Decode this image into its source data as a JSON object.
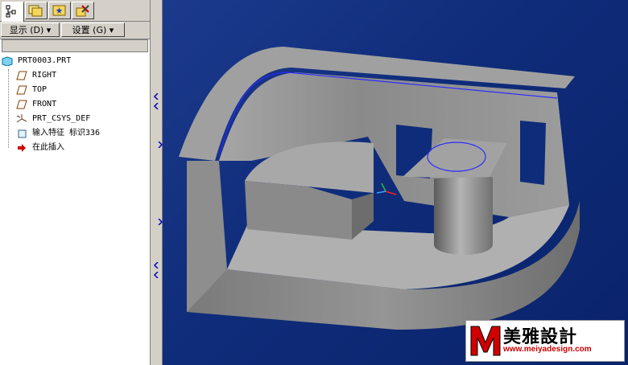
{
  "tabs": [
    {
      "icon": "model-tree-icon"
    },
    {
      "icon": "folder-browser-icon"
    },
    {
      "icon": "favorites-icon"
    },
    {
      "icon": "tools-icon"
    }
  ],
  "menu": {
    "display_label": "显示 (D)",
    "settings_label": "设置 (G)"
  },
  "tree": {
    "root": "PRT0003.PRT",
    "items": [
      {
        "label": "RIGHT",
        "icon": "datum-plane-icon"
      },
      {
        "label": "TOP",
        "icon": "datum-plane-icon"
      },
      {
        "label": "FRONT",
        "icon": "datum-plane-icon"
      },
      {
        "label": "PRT_CSYS_DEF",
        "icon": "coordinate-system-icon"
      },
      {
        "label": "输入特征 标识336",
        "icon": "import-feature-icon"
      },
      {
        "label": "在此插入",
        "icon": "insert-here-arrow-icon"
      }
    ]
  },
  "watermark": {
    "name": "美雅設計",
    "url": "www.meiyadesign.com"
  },
  "colors": {
    "viewport_bg": "#0f2c7a",
    "model_gray": "#8c8c8c",
    "edge_blue": "#2a2aff"
  }
}
